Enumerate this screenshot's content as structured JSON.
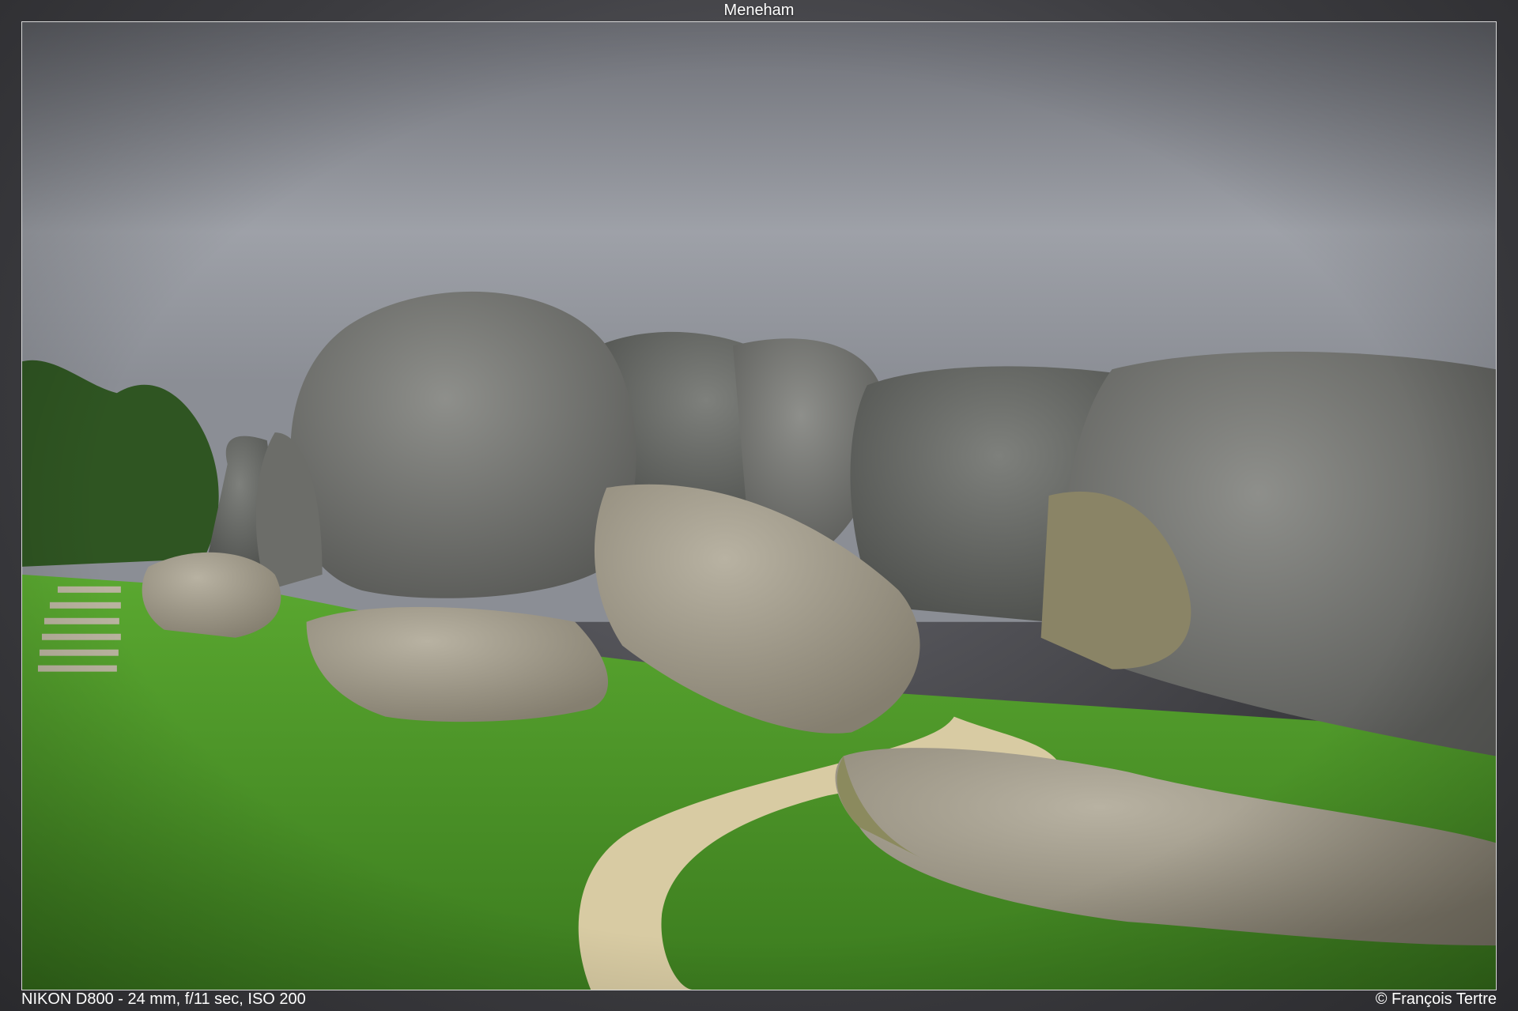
{
  "title": "Meneham",
  "camera_info": "NIKON D800 - 24 mm, f/11 sec, ISO 200",
  "copyright": "© François Tertre",
  "colors": {
    "sky": "#8d9098",
    "grass": "#4e9a2a",
    "rock": "#7a7b78",
    "path": "#d8cba3"
  }
}
